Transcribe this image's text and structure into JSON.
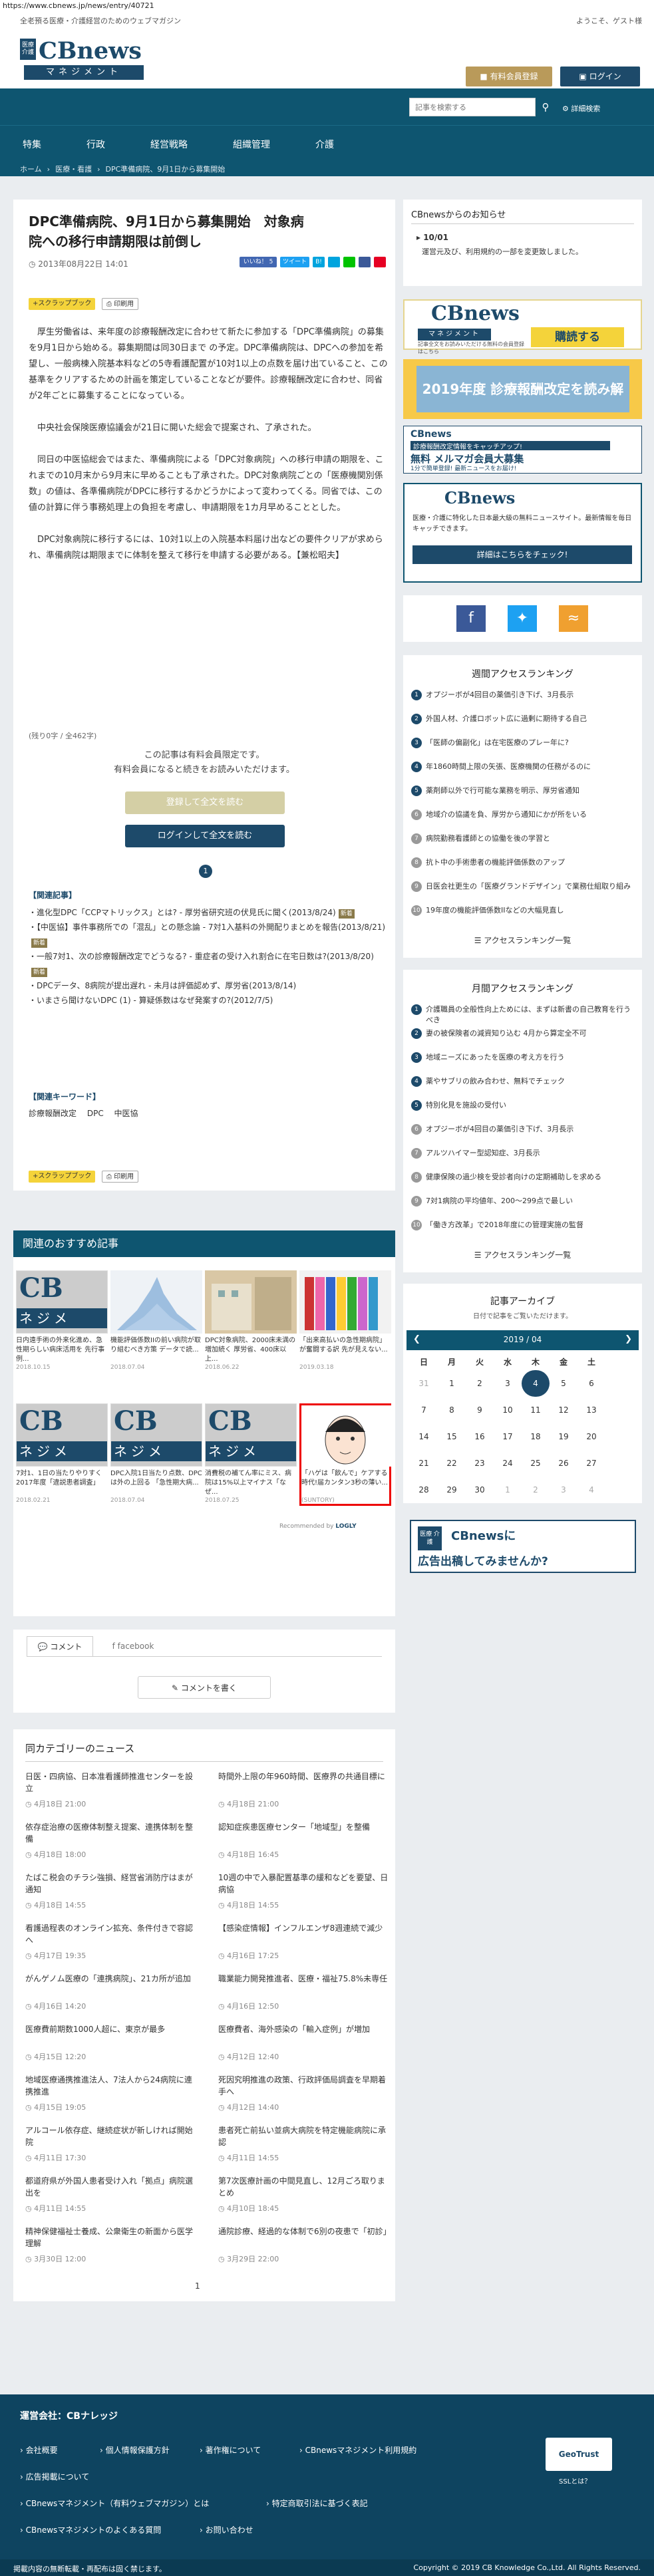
{
  "url": "https://www.cbnews.jp/news/entry/40721",
  "top": {
    "tagline": "全老預る医療・介護経営のためのウェブマガジン",
    "welcome": "ようこそ、ゲスト様"
  },
  "logo": {
    "box": "医療介護",
    "name": "CBnews",
    "sub": "マネジメント"
  },
  "header": {
    "paid_btn": "有料会員登録",
    "login_btn": "ログイン",
    "search_placeholder": "記事を検索する",
    "search_icon": "magnifier-icon",
    "advanced": "詳細検索"
  },
  "nav": [
    "特集",
    "行政",
    "経営戦略",
    "組織管理",
    "介護"
  ],
  "breadcrumb": [
    "ホーム",
    "医療・看護",
    "DPC準備病院、9月1日から募集開始"
  ],
  "article": {
    "title": "DPC準備病院、9月1日から募集開始　対象病院への移行申請期限は前倒し",
    "date": "2013年08月22日 14:01",
    "share": [
      "いいね！ 5",
      "ツイート",
      "B!",
      "はてブ",
      "LINE",
      "送る",
      "保存"
    ],
    "scrap": "スクラップブック",
    "print": "印刷用",
    "paragraphs": [
      "厚生労働省は、来年度の診療報酬改定に合わせて新たに参加する「DPC準備病院」の募集を9月1日から始める。募集期間は同30日まで の予定。DPC準備病院は、DPCへの参加を希望し、一般病棟入院基本料などの5寺看護配置が10対1以上の点数を届け出ていること、この基準をクリアするための計画を策定していることなどが要件。診療報酬改定に合わせ、同省が2年ごとに募集することになっている。",
      "中央社会保険医療協議会が21日に開いた総会で提案され、了承された。",
      "同日の中医協総会ではまた、準備病院による「DPC対象病院」への移行申請の期限を、これまでの10月末から9月末に早めることも了承された。DPC対象病院ごとの「医療機関別係数」の値は、各準備病院がDPCに移行するかどうかによって変わってくる。同省では、この値の計算に伴う事務処理上の負担を考慮し、申請期限を1カ月早めることとした。",
      "DPC対象病院に移行するには、10対1以上の入院基本料届け出などの要件クリアが求められ、準備病院は期限までに体制を整えて移行を申請する必要がある。【兼松昭夫】"
    ],
    "charcount": "(残り0字 / 全462字)",
    "paywall": [
      "この記事は有料会員限定です。",
      "有料会員になると続きをお読みいただけます。"
    ],
    "reg_btn": "登録して全文を読む",
    "login_btn": "ログインして全文を読む",
    "page": "1",
    "related_head": "【関連記事】",
    "related": [
      {
        "t": "進化型DPC「CCPマトリックス」とは? - 厚労省研究班の伏見氏に聞く(2013/8/24)",
        "new": true
      },
      {
        "t": "【中医協】事件事務所での「混乱」との懸念論 - 7対1入基料の外開配りまとめを報告(2013/8/21)",
        "new": true
      },
      {
        "t": "一般7対1、次の診療報酬改定でどうなる? - 重症者の受け入れ割合に在宅日数は?(2013/8/20)",
        "new": true
      },
      {
        "t": "DPCデータ、8病院が提出遅れ - 未月は評価認めず、厚労省(2013/8/14)",
        "new": false
      },
      {
        "t": "いまさら聞けないDPC (1) - 算疑係数はなぜ発案すの?(2012/7/5)",
        "new": false
      }
    ],
    "keyword_head": "【関連キーワード】",
    "keywords": [
      "診療報酬改定",
      "DPC",
      "中医協"
    ]
  },
  "sidebar": {
    "notice_head": "CBnewsからのお知らせ",
    "notice_date": "10/01",
    "notice_text": "運営元及び、利用規約の一部を変更致しました。",
    "banner1": {
      "brand": "CBnews",
      "sub": "マネジメント",
      "text": "記事全文をお読みいただける無料の会員登録はこちら",
      "btn": "購読する"
    },
    "banner2": "2019年度 診療報酬改定を読み解く",
    "banner3": {
      "line1": "診療報酬改定情報をキャッチアップ!",
      "line2": "無料 メルマガ会員大募集",
      "line3": "1分で簡単登録! 最新ニュースをお届け!"
    },
    "banner4": {
      "brand": "CBnews",
      "text": "医療・介護に特化した日本最大級の無料ニュースサイト。最新情報を毎日キャッチできます。",
      "btn": "詳細はこちらをチェック!"
    },
    "weekly_head": "週間アクセスランキング",
    "weekly": [
      "オプジーボが4回目の薬価引き下げ、3月長示",
      "外国人材、介護ロボット広に過剰に期待する自己",
      "「医師の偏副化」は在宅医療のプレー年に?",
      "年1860時間上限の矢張、医療機関の任務がるのに",
      "薬剤師以外で行可能な業務を明示、厚労省通知",
      "地域介の協議を負、厚労から通知にかが所をいる",
      "病院勤務看護師との協働を後の学習と",
      "抗ト中の手術患者の機能評価係数のアップ",
      "日医会社更生の「医療グランドデザイン」で業務仕組取り組み",
      "19年度の機能評価係数IIなどの大幅見直し"
    ],
    "weekly_more": "アクセスランキング一覧",
    "monthly_head": "月間アクセスランキング",
    "monthly": [
      "介護職員の全般性向上ためには、まずは新書の自己教育を行うべき",
      "妻の被保険者の減資知り込む  4月から算定全不可",
      "地域ニーズにあったを医療の考え方を行う",
      "薬やサブリの飲み合わせ、無料でチェック",
      "特別化見を施設の受付い",
      "オプジーボが4回目の薬価引き下げ、3月長示",
      "アルツハイマー型認知症、3月長示",
      "健康保険の過少検を受診者向けの定期補助しを求める",
      "7対1病院の平均値年、200～299点で最しい",
      "「働き方改革」で2018年度にの管理実施の監督"
    ],
    "monthly_more": "アクセスランキング一覧",
    "archive_head": "記事アーカイブ",
    "archive_sub": "日付で記事をご覧いただけます。",
    "cal_title": "2019 / 04",
    "cal_days": [
      "日",
      "月",
      "火",
      "水",
      "木",
      "金",
      "土"
    ],
    "cal_rows": [
      [
        "31",
        "1",
        "2",
        "3",
        "4",
        "5",
        "6"
      ],
      [
        "7",
        "8",
        "9",
        "10",
        "11",
        "12",
        "13"
      ],
      [
        "14",
        "15",
        "16",
        "17",
        "18",
        "19",
        "20"
      ],
      [
        "21",
        "22",
        "23",
        "24",
        "25",
        "26",
        "27"
      ],
      [
        "28",
        "29",
        "30",
        "1",
        "2",
        "3",
        "4"
      ]
    ],
    "ad": {
      "a": "医療 介護",
      "b": "CBnewsに",
      "c": "広告出稿してみませんか?"
    }
  },
  "rec": {
    "head": "関連のおすすめ記事",
    "cards": [
      {
        "t": "日内遠手術の外来化進め、急性期らしい病床活用を 先行事例...",
        "d": "2018.10.15"
      },
      {
        "t": "機能評価係数IIの前い病院が取り組むべき方策 データで読...",
        "d": "2018.07.04"
      },
      {
        "t": "DPC対象病院、2000床未満の増加続く 厚労省、400床以上...",
        "d": "2018.06.22"
      },
      {
        "t": "「出来高払いの急性期病院」が奮闘する訳 先が見えない...",
        "d": "2019.03.18"
      },
      {
        "t": "7対1、1日の当たりやりすく 2017年度「違説患者調査」",
        "d": "2018.02.21"
      },
      {
        "t": "DPC入院1日当たり点数、DPCは外の上回る 「急性期大病...",
        "d": "2018.07.04"
      },
      {
        "t": "消費税の補てん率にミス、病院は15%以上マイナス「なぜ...",
        "d": "2018.07.25"
      },
      {
        "t": "「ハゲは「飲んで」ケアする時代!届カンタン3秒の薄い...",
        "d": "(SUNTORY)"
      }
    ],
    "promoted": "Recommended by",
    "promoted_brand": "LOGLY"
  },
  "comments": {
    "tab1": "コメント",
    "tab2": "facebook",
    "btn": "コメントを書く"
  },
  "news": {
    "head": "同カテゴリーのニュース",
    "items": [
      {
        "t": "日医・四病協、日本准看護師推進センターを設立",
        "d": "4月18日 21:00"
      },
      {
        "t": "時間外上限の年960時間、医療界の共通目標に",
        "d": "4月18日 21:00"
      },
      {
        "t": "依存症治療の医療体制整え提案、連携体制を整備",
        "d": "4月18日 18:00"
      },
      {
        "t": "認知症疾患医療センター「地域型」を整備",
        "d": "4月18日 16:45"
      },
      {
        "t": "たばこ税会のチラシ強損、経営省消防庁はまが通知",
        "d": "4月18日 14:55"
      },
      {
        "t": "10週の中で入暴配置基準の緩和などを要望、日病協",
        "d": "4月18日 14:55"
      },
      {
        "t": "看護過程表のオンライン拡充、条件付きで容認へ",
        "d": "4月17日 19:35"
      },
      {
        "t": "【感染症情報】インフルエンザ8週連続で減少",
        "d": "4月16日 17:25"
      },
      {
        "t": "がんゲノム医療の「連携病院」、21カ所が追加",
        "d": "4月16日 14:20"
      },
      {
        "t": "職業能力開発推進者、医療・福祉75.8%未専任",
        "d": "4月16日 12:50"
      },
      {
        "t": "医療費前期数1000人超に、東京が最多",
        "d": "4月15日 12:20"
      },
      {
        "t": "医療費者、海外感染の「輸入症例」が増加",
        "d": "4月12日 12:40"
      },
      {
        "t": "地域医療通携推進法人、7法人から24病院に連携推進",
        "d": "4月15日 19:05"
      },
      {
        "t": "死因究明推進の政策、行政評価局調査を早期着手へ",
        "d": "4月12日 14:40"
      },
      {
        "t": "アルコール依存症、継続症状が新しければ開始院",
        "d": "4月11日 17:30"
      },
      {
        "t": "患者死亡前払い並病大病院を特定機能病院に承認",
        "d": "4月11日 14:55"
      },
      {
        "t": "都道府県が外国人患者受け入れ「拠点」病院選出を",
        "d": "4月11日 14:55"
      },
      {
        "t": "第7次医療計画の中間見直し、12月ごろ取りまとめ",
        "d": "4月10日 18:45"
      },
      {
        "t": "精神保健福祉士養成、公衆衛生の新面から医学理解",
        "d": "3月30日 12:00"
      },
      {
        "t": "通院診療、経過的な体制で6別の夜患で「初診」",
        "d": "3月29日 22:00"
      }
    ],
    "page": "1"
  },
  "footer": {
    "head": "運営会社：CBナレッジ",
    "links": [
      "会社概要",
      "個人情報保護方針",
      "著作権について",
      "CBnewsマネジメント利用規約",
      "広告掲載について",
      "CBnewsマネジメント（有料ウェブマガジン）とは",
      "特定商取引法に基づく表記",
      "CBnewsマネジメントのよくある質問",
      "お問い合わせ"
    ],
    "geotrust": "GeoTrust",
    "ssl": "SSLとは？",
    "note": "掲載内容の無断転載・再配布は固く禁じます。",
    "copyright": "Copyright © 2019 CB Knowledge Co.,Ltd. All Rights Reserved."
  }
}
